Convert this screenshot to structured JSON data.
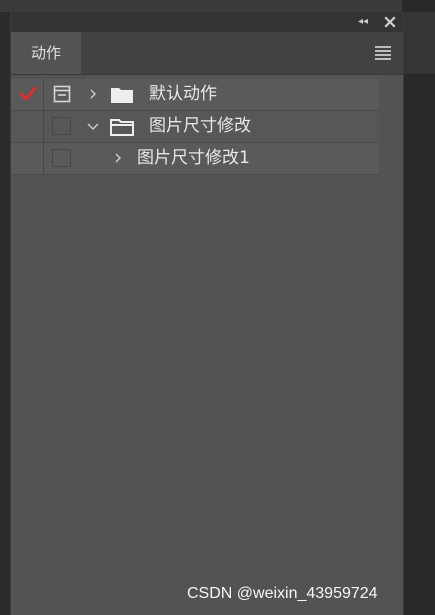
{
  "panel": {
    "tab_label": "动作",
    "collapse_glyph": "◂◂",
    "icons": {
      "collapse": "double-chevron-left-icon",
      "close": "close-icon",
      "menu": "panel-menu-icon"
    }
  },
  "actions": [
    {
      "label": "默认动作",
      "checked": true,
      "dialog_toggle": true,
      "expanded": false,
      "type": "set",
      "icon": "folder-icon"
    },
    {
      "label": "图片尺寸修改",
      "checked": false,
      "dialog_toggle": false,
      "expanded": true,
      "type": "set",
      "icon": "folder-open-icon"
    },
    {
      "label": "图片尺寸修改1",
      "checked": false,
      "dialog_toggle": false,
      "expanded": false,
      "type": "action",
      "icon": "chevron-right-icon"
    }
  ],
  "watermark": "CSDN @weixin_43959724",
  "colors": {
    "panel_bg": "#535353",
    "check_red": "#d8322f",
    "text": "#e8e8e8"
  }
}
